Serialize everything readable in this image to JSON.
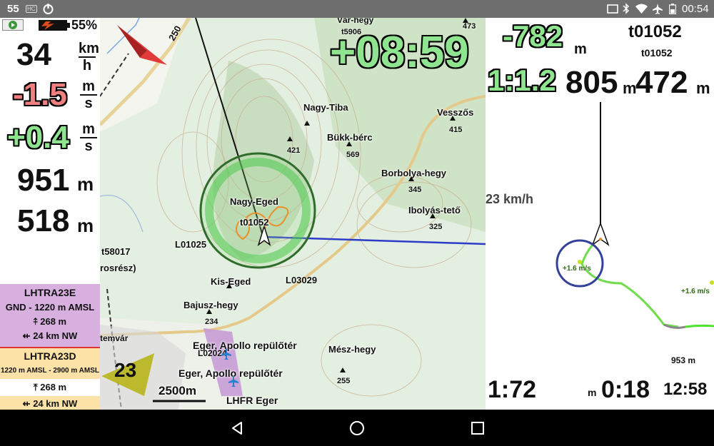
{
  "status_bar": {
    "notification_count": "55",
    "hc_label": "HC",
    "time": "00:54"
  },
  "left_panel": {
    "battery_percent": "55%",
    "speed": {
      "value": "34",
      "unit_top": "km",
      "unit_bottom": "h"
    },
    "vario_avg": {
      "value": "-1.5",
      "unit_top": "m",
      "unit_bottom": "s"
    },
    "vario": {
      "value": "+0.4",
      "unit_top": "m",
      "unit_bottom": "s"
    },
    "altitude": {
      "value": "951",
      "unit": "m"
    },
    "height": {
      "value": "518",
      "unit": "m"
    },
    "airspace_1": {
      "name": "LHTRA23E",
      "limits": "GND - 1220 m AMSL",
      "vertical_distance": "268 m",
      "horizontal_distance": "24 km NW",
      "color": "#d8b0e0"
    },
    "airspace_2": {
      "name": "LHTRA23D",
      "limits": "1220 m AMSL - 2900 m AMSL",
      "vertical_distance": "268 m",
      "horizontal_distance": "24 km NW",
      "color": "#fde2a8"
    }
  },
  "map": {
    "timer": "+08:59",
    "wind_speed": "23 km/h",
    "scale_label": "2500m",
    "thermal_number": "23",
    "heading_label": "250",
    "labels": {
      "nagy_tiba": "Nagy-Tiba",
      "bukk_berc": "Bükk-bérc",
      "bukk_berc_alt": "569",
      "vesszos": "Vesszős",
      "vesszos_alt": "415",
      "borbolya": "Borbolya-hegy",
      "borbolya_alt": "345",
      "ibolyas": "Ibolyás-tető",
      "ibolyas_alt": "325",
      "nagy_eged": "Nagy-Eged",
      "nagy_eged_alt": "421",
      "turnpoint": "t01052",
      "l01025": "L01025",
      "t58017": "t58017",
      "rosresz": "rosrész)",
      "l03029": "L03029",
      "kis_eged": "Kis-Eged",
      "bajusz": "Bajusz-hegy",
      "bajusz_alt": "234",
      "eger_apollo_1": "Eger, Apollo repülőtér",
      "l02024": "L02024",
      "eger_apollo_2": "Eger, Apollo repülőtér",
      "lhfr": "LHFR Eger",
      "mesz": "Mész-hegy",
      "mesz_alt": "255",
      "var_hegy": "Vár-hegy",
      "t59064": "t5906",
      "alt_473": "473",
      "temvar": "temvár"
    },
    "colors": {
      "thermal_ring": "#4cc94c",
      "track": "#e8902a",
      "course_line": "#2d3cc8",
      "wind_arrow": "#555555"
    }
  },
  "right_panel": {
    "glide_diff": {
      "value": "-782",
      "unit": "m"
    },
    "glide_ratio": "1:1.2",
    "waypoint_name": "t01052",
    "waypoint_name_small": "t01052",
    "distance": {
      "value": "805",
      "unit": "m"
    },
    "altitude_arrival": {
      "value": "472",
      "unit": "m"
    },
    "thermal_climb_1": "+1.6 m/s",
    "thermal_climb_2": "+1.6 m/s",
    "thermal_alt": "953 m",
    "ld_ratio": "1:72",
    "time_to_go_unit": "m",
    "time_to_go": "0:18",
    "clock": "12:58"
  }
}
